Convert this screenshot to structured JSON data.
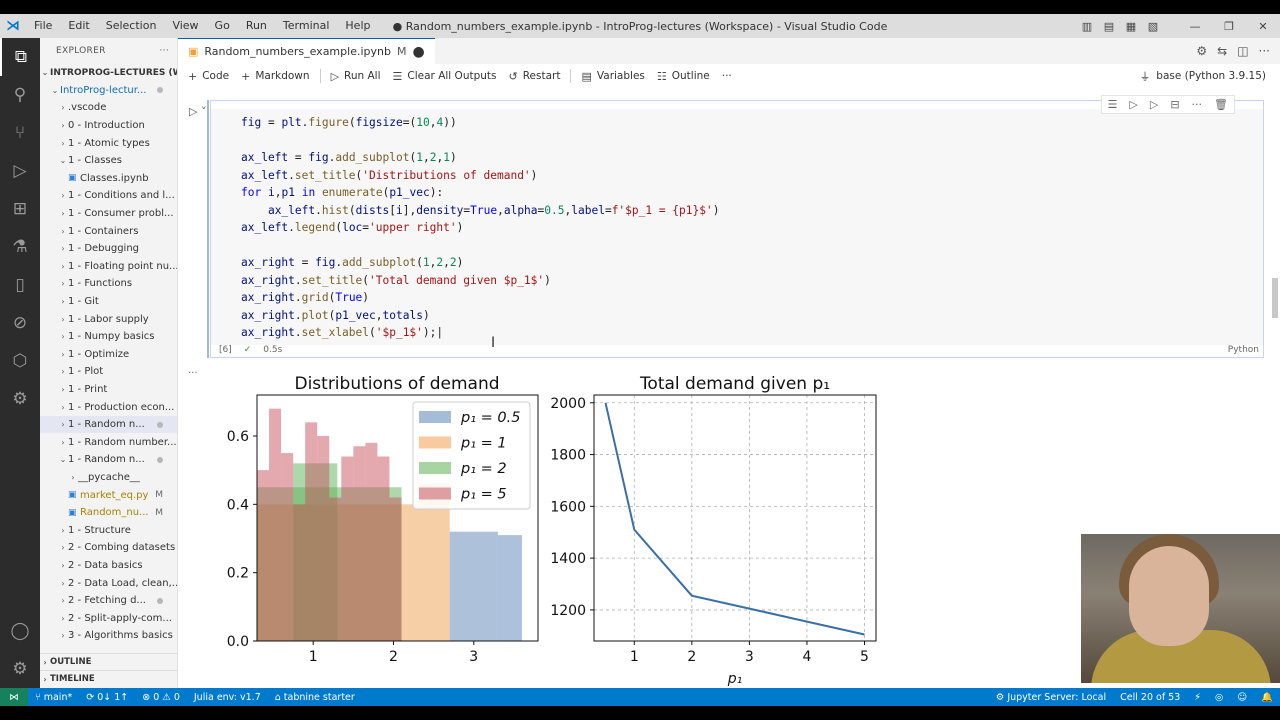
{
  "menu": [
    "File",
    "Edit",
    "Selection",
    "View",
    "Go",
    "Run",
    "Terminal",
    "Help"
  ],
  "window_title": "● Random_numbers_example.ipynb - IntroProg-lectures (Workspace) - Visual Studio Code",
  "sidebar": {
    "header": "EXPLORER",
    "workspace": "INTROPROG-LECTURES (W...",
    "root": "IntroProg-lectur...",
    "items": [
      {
        "label": ".vscode",
        "indent": 1
      },
      {
        "label": "0 - Introduction",
        "indent": 1
      },
      {
        "label": "1 - Atomic types",
        "indent": 1
      },
      {
        "label": "1 - Classes",
        "indent": 1,
        "open": true
      },
      {
        "label": "Classes.ipynb",
        "indent": 2,
        "file": true
      },
      {
        "label": "1 - Conditions and l...",
        "indent": 1
      },
      {
        "label": "1 - Consumer probl...",
        "indent": 1
      },
      {
        "label": "1 - Containers",
        "indent": 1
      },
      {
        "label": "1 - Debugging",
        "indent": 1
      },
      {
        "label": "1 - Floating point nu...",
        "indent": 1
      },
      {
        "label": "1 - Functions",
        "indent": 1
      },
      {
        "label": "1 - Git",
        "indent": 1
      },
      {
        "label": "1 - Labor supply",
        "indent": 1
      },
      {
        "label": "1 - Numpy basics",
        "indent": 1
      },
      {
        "label": "1 - Optimize",
        "indent": 1
      },
      {
        "label": "1 - Plot",
        "indent": 1
      },
      {
        "label": "1 - Print",
        "indent": 1
      },
      {
        "label": "1 - Production econ...",
        "indent": 1
      },
      {
        "label": "1 - Random n...",
        "indent": 1,
        "dot": true,
        "selected": true
      },
      {
        "label": "1 - Random number...",
        "indent": 1
      },
      {
        "label": "1 - Random n...",
        "indent": 1,
        "dot": true,
        "open": true
      },
      {
        "label": "__pycache__",
        "indent": 2
      },
      {
        "label": "market_eq.py",
        "indent": 2,
        "file": true,
        "badge": "M"
      },
      {
        "label": "Random_nu...",
        "indent": 2,
        "file": true,
        "badge": "M"
      },
      {
        "label": "1 - Structure",
        "indent": 1
      },
      {
        "label": "2 - Combing datasets",
        "indent": 1
      },
      {
        "label": "2 - Data basics",
        "indent": 1
      },
      {
        "label": "2 - Data Load, clean,...",
        "indent": 1
      },
      {
        "label": "2 - Fetching d...",
        "indent": 1,
        "dot": true
      },
      {
        "label": "2 - Split-apply-com...",
        "indent": 1
      },
      {
        "label": "3 - Algorithms basics",
        "indent": 1
      }
    ],
    "outline": "OUTLINE",
    "timeline": "TIMELINE"
  },
  "tab": {
    "label": "Random_numbers_example.ipynb",
    "modified": "M"
  },
  "toolbar": {
    "code": "Code",
    "markdown": "Markdown",
    "run_all": "Run All",
    "clear_outputs": "Clear All Outputs",
    "restart": "Restart",
    "variables": "Variables",
    "outline": "Outline",
    "more": "···",
    "kernel": "base (Python 3.9.15)"
  },
  "cell": {
    "exec_count": "[6]",
    "time": "0.5s",
    "language": "Python"
  },
  "chart_data": [
    {
      "type": "bar",
      "title": "Distributions of demand",
      "xlabel": "",
      "ylabel": "",
      "ylim": [
        0,
        0.72
      ],
      "xlim": [
        0.3,
        3.8
      ],
      "xticks": [
        "1",
        "2",
        "3"
      ],
      "yticks": [
        "0.0",
        "0.2",
        "0.4",
        "0.6"
      ],
      "legend_position": "upper right",
      "series": [
        {
          "name": "p1 = 0.5",
          "color": "#5b85b5",
          "bins": [
            [
              0.3,
              3.8,
              0.0
            ],
            [
              2.7,
              3.3,
              0.32
            ],
            [
              3.3,
              3.6,
              0.31
            ]
          ]
        },
        {
          "name": "p1 = 1",
          "color": "#f0a050",
          "bins": [
            [
              0.3,
              2.3,
              0.4
            ],
            [
              2.3,
              2.7,
              0.46
            ]
          ]
        },
        {
          "name": "p1 = 2",
          "color": "#60b05a",
          "bins": [
            [
              0.3,
              2.1,
              0.45
            ],
            [
              0.75,
              1.3,
              0.52
            ]
          ]
        },
        {
          "name": "p1 = 5",
          "color": "#c85460",
          "bins": [
            [
              0.3,
              0.45,
              0.5
            ],
            [
              0.45,
              0.6,
              0.68
            ],
            [
              0.6,
              0.75,
              0.55
            ],
            [
              0.75,
              0.9,
              0.4
            ],
            [
              0.9,
              1.05,
              0.64
            ],
            [
              1.05,
              1.2,
              0.6
            ],
            [
              1.2,
              1.35,
              0.42
            ],
            [
              1.35,
              1.5,
              0.54
            ],
            [
              1.5,
              1.65,
              0.57
            ],
            [
              1.65,
              1.8,
              0.58
            ],
            [
              1.8,
              1.95,
              0.54
            ],
            [
              1.95,
              2.1,
              0.42
            ]
          ]
        }
      ]
    },
    {
      "type": "line",
      "title": "Total demand given p1",
      "xlabel": "p1",
      "ylabel": "",
      "xlim": [
        0.3,
        5.2
      ],
      "ylim": [
        1080,
        2030
      ],
      "xticks": [
        "1",
        "2",
        "3",
        "4",
        "5"
      ],
      "yticks": [
        "1200",
        "1400",
        "1600",
        "1800",
        "2000"
      ],
      "grid": true,
      "x": [
        0.5,
        1,
        2,
        3,
        4,
        5
      ],
      "y": [
        2000,
        1510,
        1255,
        1205,
        1155,
        1105
      ]
    }
  ],
  "statusbar": {
    "branch": "main*",
    "sync": "0↓ 1↑",
    "problems": "⊗ 0 ⚠ 0",
    "julia": "Julia env: v1.7",
    "tabnine": "⌂ tabnine starter",
    "jupyter": "Jupyter Server: Local",
    "cell_pos": "Cell 20 of 53"
  },
  "legend_labels": [
    "p₁ = 0.5",
    "p₁ = 1",
    "p₁ = 2",
    "p₁ = 5"
  ],
  "chart_titles": [
    "Distributions of demand",
    "Total demand given p₁"
  ],
  "axis_x_label": "p₁"
}
